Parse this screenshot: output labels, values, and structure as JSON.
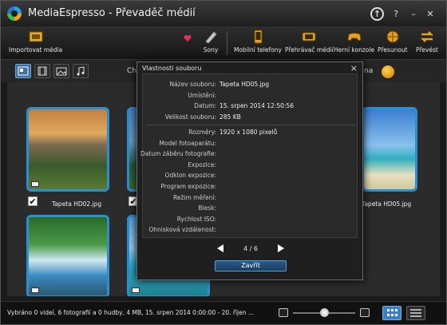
{
  "window": {
    "title": "MediaEspresso - Převaděč médií"
  },
  "toolbar": {
    "import_label": "Importovat média",
    "sony_label": "Sony",
    "phones_label": "Mobilní telefony",
    "player_label": "Přehrávač médií",
    "consoles_label": "Herní konzole",
    "move_label": "Přesunout",
    "convert_label": "Převést"
  },
  "subbar": {
    "left_fragment": "Ch",
    "right_fragment": "na"
  },
  "thumbnails": [
    {
      "label": "Tapeta HD02.jpg",
      "checked": true
    },
    {
      "label": "",
      "checked": true
    },
    {
      "label": "Tapeta HD05.jpg",
      "checked": false
    },
    {
      "label": "",
      "checked": false
    },
    {
      "label": "",
      "checked": false
    }
  ],
  "dialog": {
    "title": "Vlastnosti souboru",
    "close_icon": "×",
    "rows": [
      {
        "key": "Název souboru:",
        "value": "Tapeta HD05.jpg"
      },
      {
        "key": "Umístění:",
        "value": ""
      },
      {
        "key": "Datum:",
        "value": "15. srpen 2014 12:50:56"
      },
      {
        "key": "Velikost souboru:",
        "value": "285 KB"
      },
      {
        "key": "Rozměry:",
        "value": "1920 x 1080 pixelů"
      },
      {
        "key": "Model fotoaparátu:",
        "value": ""
      },
      {
        "key": "Datum záběru fotografie:",
        "value": ""
      },
      {
        "key": "Expozice:",
        "value": ""
      },
      {
        "key": "Odklon expozice:",
        "value": ""
      },
      {
        "key": "Program expozice:",
        "value": ""
      },
      {
        "key": "Režim měření:",
        "value": ""
      },
      {
        "key": "Blesk:",
        "value": ""
      },
      {
        "key": "Rychlost ISO:",
        "value": ""
      },
      {
        "key": "Ohnisková vzdálenost:",
        "value": ""
      }
    ],
    "counter": "4 / 6",
    "close_button": "Zavřít"
  },
  "status": {
    "text": "Vybráno 0 videí, 6 fotografií a 0 hudby, 4 MB, 15. srpen 2014 0:00:00 - 20. říjen ...",
    "zoom_level": 0.5
  },
  "colors": {
    "accent": "#2c8fd0",
    "selected_button": "#3a7fc8"
  }
}
